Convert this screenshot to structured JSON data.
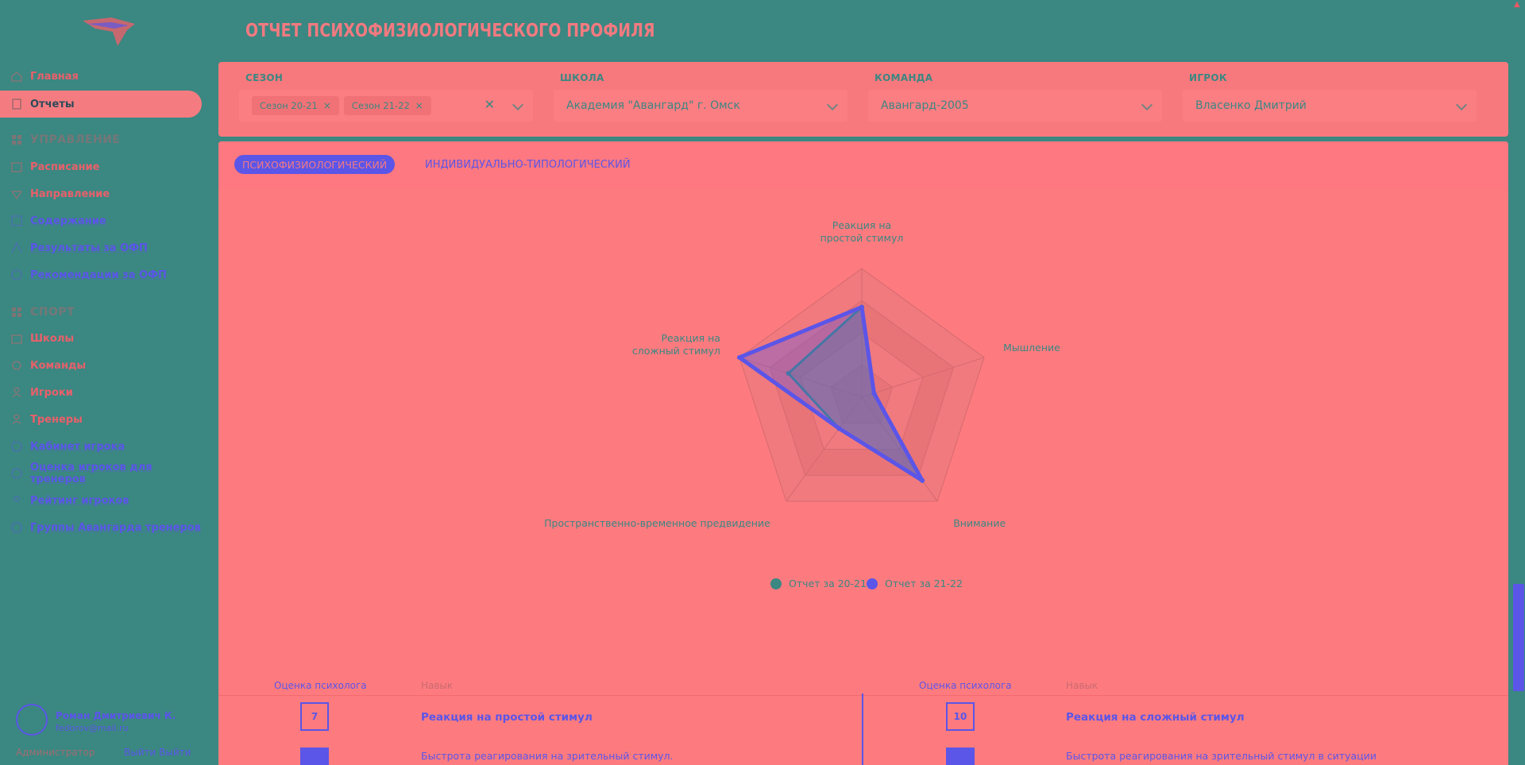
{
  "sidebar": {
    "items": [
      {
        "label": "Главная",
        "icon": "home-icon"
      },
      {
        "label": "Отчеты",
        "icon": "report-icon"
      },
      {
        "label": "Расписание",
        "icon": "calendar-icon"
      },
      {
        "label": "Направление",
        "icon": "direction-icon"
      },
      {
        "label": "Содержание",
        "icon": "content-icon"
      },
      {
        "label": "Результаты за ОФП",
        "icon": "results-icon"
      },
      {
        "label": "Рекомендации за ОФП",
        "icon": "recommend-icon"
      },
      {
        "label": "Школы",
        "icon": "school-icon"
      },
      {
        "label": "Команды",
        "icon": "team-icon"
      },
      {
        "label": "Игроки",
        "icon": "player-icon"
      },
      {
        "label": "Тренеры",
        "icon": "coach-icon"
      },
      {
        "label": "Кабинет игрока",
        "icon": "cabinet-icon"
      },
      {
        "label": "Оценка игроков для тренеров",
        "icon": "rating-icon"
      },
      {
        "label": "Рейтинг игроков",
        "icon": "ranking-icon"
      },
      {
        "label": "Группы Авангарда тренеров",
        "icon": "group-icon"
      }
    ],
    "sections": [
      "УПРАВЛЕНИЕ",
      "СПОРТ"
    ],
    "user": {
      "name": "Роман Дмитриевич К.",
      "email": "fedorov@mail.ru",
      "role": "Администратор",
      "logout": "Выйти Выйти"
    }
  },
  "header": {
    "title": "ОТЧЕТ ПСИХОФИЗИОЛОГИЧЕСКОГО ПРОФИЛЯ"
  },
  "filters": {
    "season": {
      "label": "СЕЗОН",
      "chips": [
        "Сезон 20-21",
        "Сезон 21-22"
      ]
    },
    "school": {
      "label": "ШКОЛА",
      "value": "Академия \"Авангард\" г. Омск"
    },
    "team": {
      "label": "КОМАНДА",
      "value": "Авангард-2005"
    },
    "player": {
      "label": "ИГРОК",
      "value": "Власенко Дмитрий"
    }
  },
  "tabs": {
    "active": "ПСИХОФИЗИОЛОГИЧЕСКИЙ",
    "other": "ИНДИВИДУАЛЬНО-ТИПОЛОГИЧЕСКИЙ"
  },
  "chart_data": {
    "type": "radar",
    "axes": [
      "Реакция на простой стимул",
      "Мышление",
      "Внимание",
      "Пространственно-временное предвидение",
      "Реакция на сложный стимул"
    ],
    "axis_label_lines": [
      [
        "Реакция на",
        "простой стимул"
      ],
      [
        "Мышление"
      ],
      [
        "Внимание"
      ],
      [
        "Пространственно-временное предвидение"
      ],
      [
        "Реакция на",
        "сложный стимул"
      ]
    ],
    "max": 10,
    "rings": 4,
    "series": [
      {
        "name": "Отчет за 20-21",
        "color": "#3b8782",
        "values": [
          7,
          1,
          8,
          3,
          6
        ]
      },
      {
        "name": "Отчет за 21-22",
        "color": "#5b55e8",
        "values": [
          7,
          1,
          8,
          3,
          10
        ]
      }
    ]
  },
  "table": {
    "left": {
      "col_score": "Оценка психолога",
      "col_skill": "Навык",
      "score": "7",
      "skill": "Реакция на простой стимул",
      "subskill": "Быстрота реагирования на зрительный стимул."
    },
    "right": {
      "col_score": "Оценка психолога",
      "col_skill": "Навык",
      "score": "10",
      "skill": "Реакция на сложный стимул",
      "subskill": "Быстрота реагирования на зрительный стимул в ситуации"
    }
  },
  "colors": {
    "bg": "#3b8782",
    "panel": "#fd7b7f",
    "accent": "#5b55e8"
  }
}
